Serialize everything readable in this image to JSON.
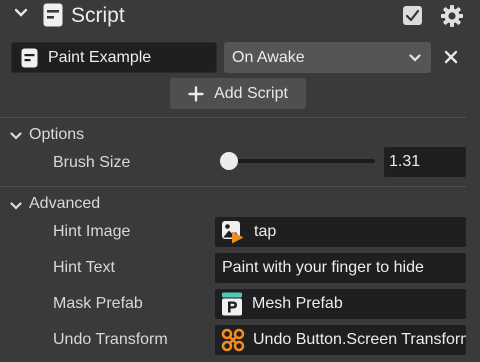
{
  "header": {
    "title": "Script"
  },
  "script_row": {
    "name": "Paint Example",
    "event": "On Awake"
  },
  "add_button": {
    "label": "Add Script"
  },
  "options": {
    "title": "Options",
    "brush_size": {
      "label": "Brush Size",
      "value": "1.31"
    }
  },
  "advanced": {
    "title": "Advanced",
    "fields": [
      {
        "label": "Hint Image",
        "value": "tap"
      },
      {
        "label": "Hint Text",
        "value": "Paint with your finger to hide"
      },
      {
        "label": "Mask Prefab",
        "value": "Mesh Prefab"
      },
      {
        "label": "Undo Transform",
        "value": "Undo Button.Screen Transform"
      }
    ]
  }
}
